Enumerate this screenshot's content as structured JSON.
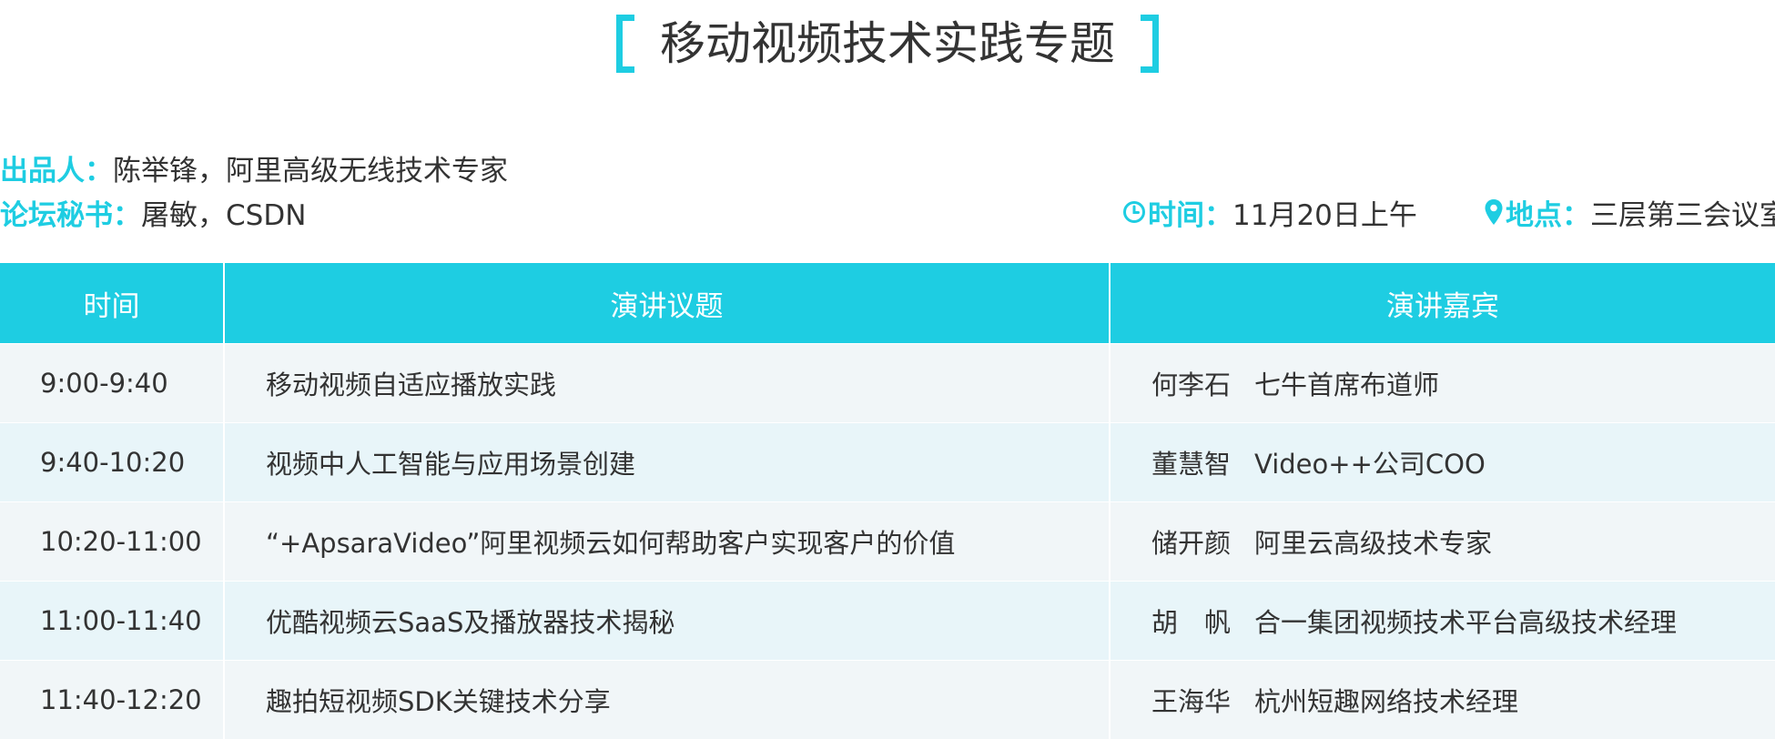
{
  "title": "移动视频技术实践专题",
  "producer": {
    "label": "出品人：",
    "value": "陈举锋，阿里高级无线技术专家"
  },
  "secretary": {
    "label": "论坛秘书：",
    "value": "屠敏，CSDN"
  },
  "time": {
    "icon": "clock-icon",
    "label": "时间：",
    "value": "11月20日上午"
  },
  "place": {
    "icon": "location-pin-icon",
    "label": "地点：",
    "value": "三层第三会议室"
  },
  "colors": {
    "accent": "#1ecde2",
    "row_odd": "#f1f6f8",
    "row_even": "#e8f5f9",
    "text": "#333333"
  },
  "table": {
    "headers": [
      "时间",
      "演讲议题",
      "演讲嘉宾"
    ],
    "rows": [
      {
        "time": "9:00-9:40",
        "topic": "移动视频自适应播放实践",
        "speaker": "何李石",
        "title": "七牛首席布道师"
      },
      {
        "time": "9:40-10:20",
        "topic": "视频中人工智能与应用场景创建",
        "speaker": "董慧智",
        "title": "Video++公司COO"
      },
      {
        "time": "10:20-11:00",
        "topic": "“+ApsaraVideo”阿里视频云如何帮助客户实现客户的价值",
        "speaker": "储开颜",
        "title": "阿里云高级技术专家"
      },
      {
        "time": "11:00-11:40",
        "topic": "优酷视频云SaaS及播放器技术揭秘",
        "speaker": "胡　帆",
        "title": "合一集团视频技术平台高级技术经理"
      },
      {
        "time": "11:40-12:20",
        "topic": "趣拍短视频SDK关键技术分享",
        "speaker": "王海华",
        "title": "杭州短趣网络技术经理"
      }
    ]
  }
}
